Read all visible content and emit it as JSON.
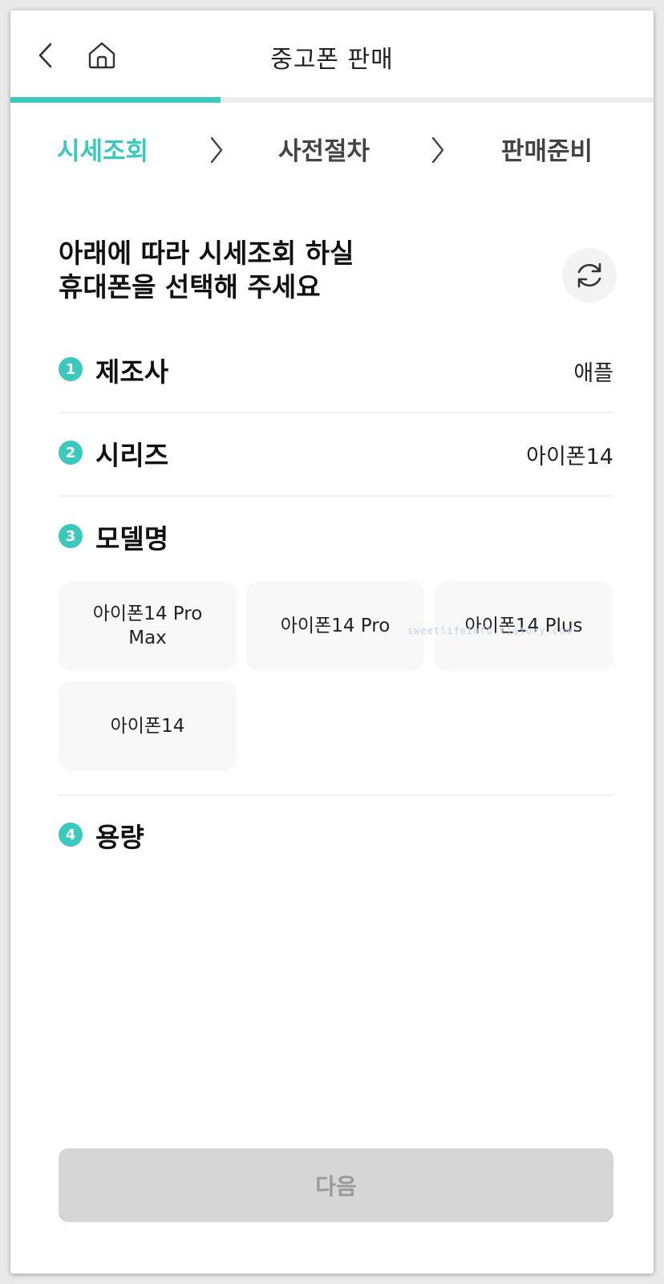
{
  "header": {
    "title": "중고폰 판매",
    "back_icon": "chevron-left-icon",
    "home_icon": "home-icon"
  },
  "progress": {
    "fraction": 0.327,
    "color": "#3cc9bd"
  },
  "steps": [
    {
      "label": "시세조회",
      "active": true
    },
    {
      "label": "사전절차",
      "active": false
    },
    {
      "label": "판매준비",
      "active": false
    }
  ],
  "heading": {
    "line1": "아래에 따라 시세조회 하실",
    "line2": "휴대폰을 선택해 주세요",
    "refresh_icon": "refresh-icon"
  },
  "sections": {
    "manufacturer": {
      "num": "1",
      "label": "제조사",
      "value": "애플"
    },
    "series": {
      "num": "2",
      "label": "시리즈",
      "value": "아이폰14"
    },
    "model": {
      "num": "3",
      "label": "모델명"
    },
    "capacity": {
      "num": "4",
      "label": "용량"
    }
  },
  "models": [
    {
      "label": "아이폰14 Pro Max"
    },
    {
      "label": "아이폰14 Pro"
    },
    {
      "label": "아이폰14 Plus"
    },
    {
      "label": "아이폰14"
    }
  ],
  "watermark": "sweetlifeinfo.tistory.com",
  "next_button": {
    "label": "다음"
  },
  "colors": {
    "accent": "#3cc9bd",
    "disabled": "#d6d6d6"
  }
}
